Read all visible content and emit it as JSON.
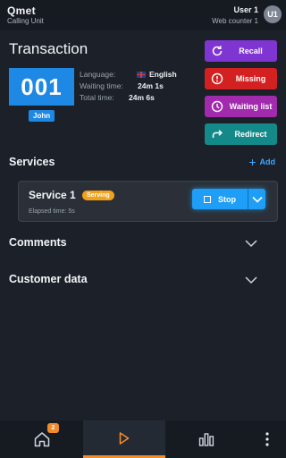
{
  "header": {
    "logo_text": "Qmet",
    "app_subtitle": "Calling Unit",
    "user_name": "User 1",
    "workstation": "Web counter 1",
    "avatar_initials": "U1"
  },
  "transaction": {
    "title": "Transaction",
    "ticket_number": "001",
    "customer_name": "John",
    "language_label": "Language:",
    "language_value": "English",
    "waiting_label": "Waiting time:",
    "waiting_value": "24m 1s",
    "total_label": "Total time:",
    "total_value": "24m 6s"
  },
  "actions": {
    "recall": "Recall",
    "missing": "Missing",
    "waiting_list": "Waiting list",
    "redirect": "Redirect"
  },
  "services": {
    "title": "Services",
    "add_label": "Add",
    "items": [
      {
        "name": "Service 1",
        "status": "Serving",
        "elapsed": "Elapsed time: 5s",
        "stop_label": "Stop"
      }
    ]
  },
  "sections": {
    "comments": "Comments",
    "customer_data": "Customer data"
  },
  "bottom_nav": {
    "home_badge": "2"
  },
  "colors": {
    "background": "#1c2129",
    "accent_blue": "#1e88e5",
    "recall": "#7e35d2",
    "missing": "#d32020",
    "waiting_list": "#a12aae",
    "redirect": "#14898a",
    "serving_badge": "#f0a21c",
    "active_tab": "#f28c28"
  },
  "icons": {
    "recall": "refresh-icon",
    "missing": "alert-circle-icon",
    "waiting_list": "clock-icon",
    "redirect": "redirect-arrow-icon",
    "nav_home": "home-icon",
    "nav_play": "play-icon",
    "nav_stats": "bar-chart-icon",
    "nav_more": "more-vertical-icon"
  }
}
